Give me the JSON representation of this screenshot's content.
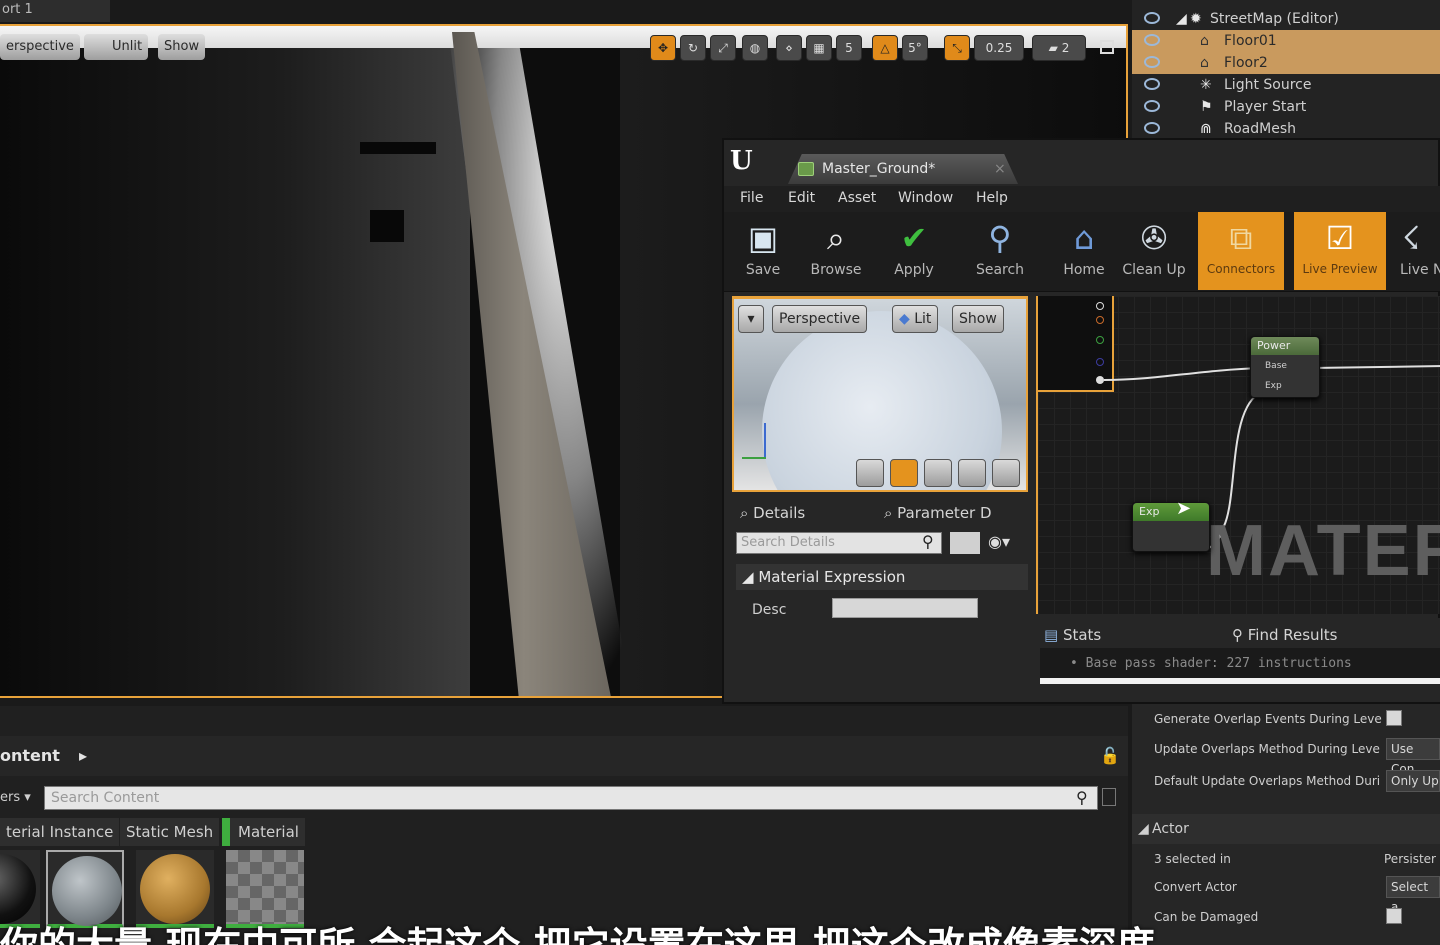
{
  "top_tab": {
    "label": "ort 1"
  },
  "viewport": {
    "perspective_label": "erspective",
    "unlit_label": "Unlit",
    "show_label": "Show",
    "grid_snap": "5",
    "rotation_snap": "5°",
    "scale_snap": "0.25",
    "camera_speed": "2",
    "accent_color": "#e8a23a"
  },
  "outliner": {
    "items": [
      {
        "label": "StreetMap (Editor)",
        "icon": "world-icon",
        "selected": false
      },
      {
        "label": "Floor01",
        "icon": "house-icon",
        "selected": true
      },
      {
        "label": "Floor2",
        "icon": "house-icon",
        "selected": true
      },
      {
        "label": "Light Source",
        "icon": "light-icon",
        "selected": false
      },
      {
        "label": "Player Start",
        "icon": "player-start-icon",
        "selected": false
      },
      {
        "label": "RoadMesh",
        "icon": "mesh-icon",
        "selected": false
      }
    ]
  },
  "material_editor": {
    "tab_title": "Master_Ground*",
    "menu": [
      "File",
      "Edit",
      "Asset",
      "Window",
      "Help"
    ],
    "toolbar": [
      {
        "label": "Save",
        "icon": "save-icon",
        "active": false
      },
      {
        "label": "Browse",
        "icon": "browse-icon",
        "active": false
      },
      {
        "label": "Apply",
        "icon": "apply-icon",
        "active": false
      },
      {
        "label": "Search",
        "icon": "search-icon",
        "active": false
      },
      {
        "label": "Home",
        "icon": "home-icon",
        "active": false
      },
      {
        "label": "Clean Up",
        "icon": "clean-up-icon",
        "active": false
      },
      {
        "label": "Connectors",
        "icon": "connectors-icon",
        "active": true
      },
      {
        "label": "Live Preview",
        "icon": "live-preview-icon",
        "active": true
      },
      {
        "label": "Live N",
        "icon": "live-nodes-icon",
        "active": false
      }
    ],
    "preview": {
      "perspective_label": "Perspective",
      "lit_label": "Lit",
      "show_label": "Show"
    },
    "details": {
      "tab_details": "Details",
      "tab_parameter": "Parameter D",
      "search_placeholder": "Search Details",
      "section_title": "Material Expression",
      "desc_label": "Desc",
      "desc_value": ""
    },
    "graph": {
      "power_node_title": "Power",
      "power_pin_base": "Base",
      "power_pin_exp": "Exp",
      "exp_node_title": "Exp",
      "watermark": "MATERI"
    },
    "stats": {
      "tab_stats": "Stats",
      "tab_find": "Find Results",
      "line": "•  Base pass shader: 227 instructions"
    }
  },
  "content_browser": {
    "title": "ontent",
    "filters_label": "ers",
    "search_placeholder": "Search Content",
    "filters": [
      "terial Instance",
      "Static Mesh",
      "Material"
    ]
  },
  "right_details": {
    "rows": [
      {
        "label": "Generate Overlap Events During Leve",
        "value": ""
      },
      {
        "label": "Update Overlaps Method During Leve",
        "value": "Use Con"
      },
      {
        "label": "Default Update Overlaps Method Duri",
        "value": "Only Up"
      }
    ],
    "actor_section": "Actor",
    "actor_rows": [
      {
        "label": "3 selected in",
        "value": "Persister"
      },
      {
        "label": "Convert Actor",
        "value": "Select a"
      },
      {
        "label": "Can be Damaged",
        "value": ""
      }
    ]
  },
  "subtitle": "你的大量 现在中可所 合起这个 把它设置在这里 把这个改成像素深度"
}
